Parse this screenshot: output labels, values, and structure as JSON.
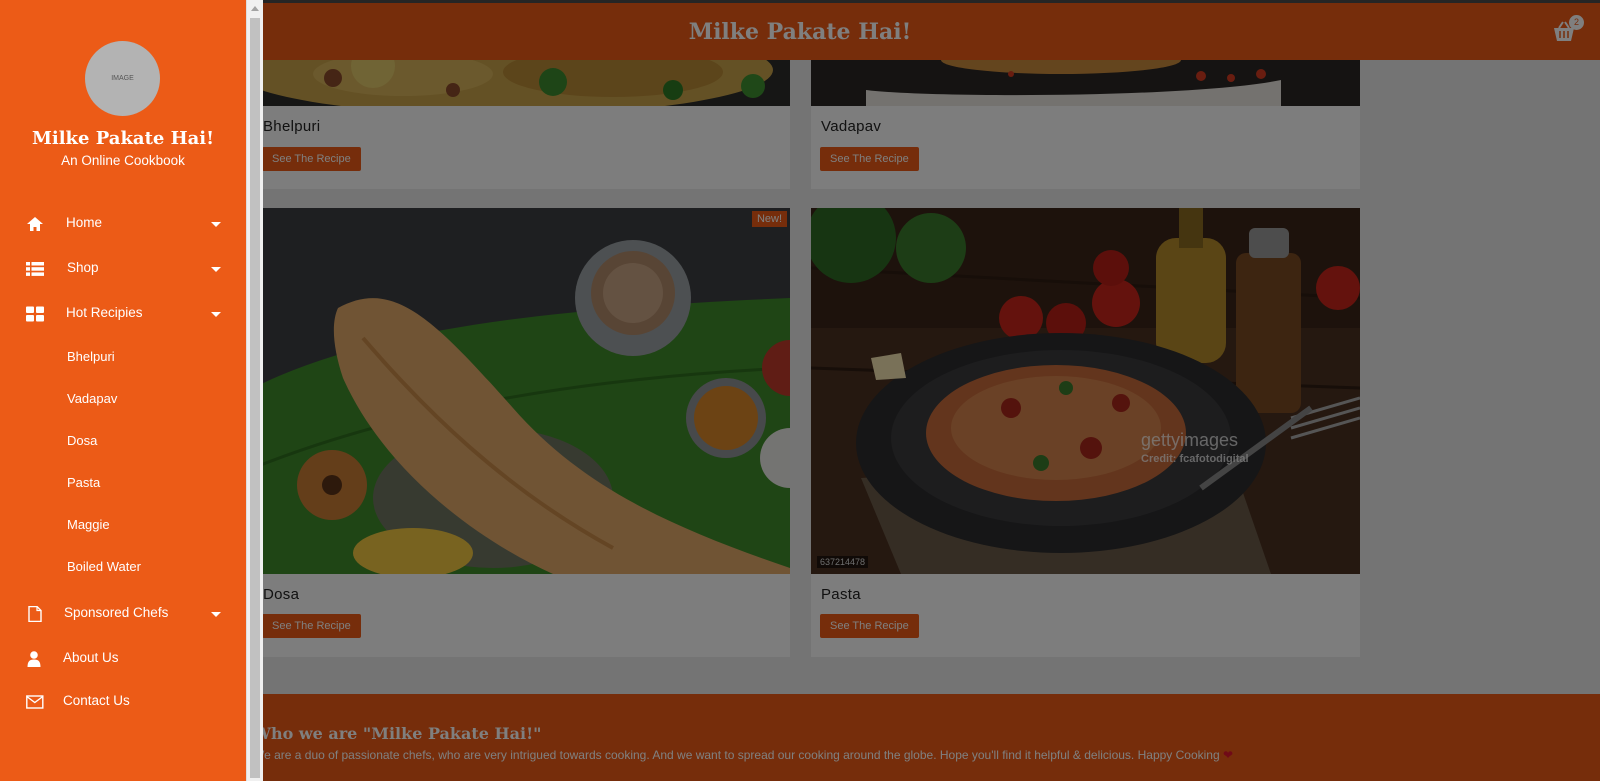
{
  "header": {
    "title": "Milke Pakate Hai!",
    "cart_count": "2"
  },
  "recipes": [
    {
      "title": "Bhelpuri",
      "button": "See The Recipe"
    },
    {
      "title": "Vadapav",
      "button": "See The Recipe"
    },
    {
      "title": "Dosa",
      "button": "See The Recipe",
      "badge": "New!"
    },
    {
      "title": "Pasta",
      "button": "See The Recipe",
      "image_tag": "637214478",
      "watermark": "gettyimages",
      "credit": "Credit: fcafotodigital"
    }
  ],
  "footer": {
    "title": "Who we are \"Milke Pakate Hai!\"",
    "text": "We are a duo of passionate chefs, who are very intrigued towards cooking. And we want to spread our cooking around the globe. Hope you'll find it helpful & delicious. Happy Cooking"
  },
  "sidebar": {
    "avatar_text": "IMAGE",
    "title": "Milke Pakate Hai!",
    "subtitle": "An Online Cookbook",
    "nav": [
      {
        "label": "Home",
        "icon": "home-icon"
      },
      {
        "label": "Shop",
        "icon": "list-icon"
      },
      {
        "label": "Hot Recipies",
        "icon": "grid-icon"
      },
      {
        "label": "Sponsored Chefs",
        "icon": "document-icon"
      },
      {
        "label": "About Us",
        "icon": "user-icon"
      },
      {
        "label": "Contact Us",
        "icon": "envelope-icon"
      }
    ],
    "sub_items": [
      "Bhelpuri",
      "Vadapav",
      "Dosa",
      "Pasta",
      "Maggie",
      "Boiled Water"
    ]
  },
  "colors": {
    "accent": "#ec5b17",
    "overlay": "rgba(0,0,0,0.5)"
  }
}
